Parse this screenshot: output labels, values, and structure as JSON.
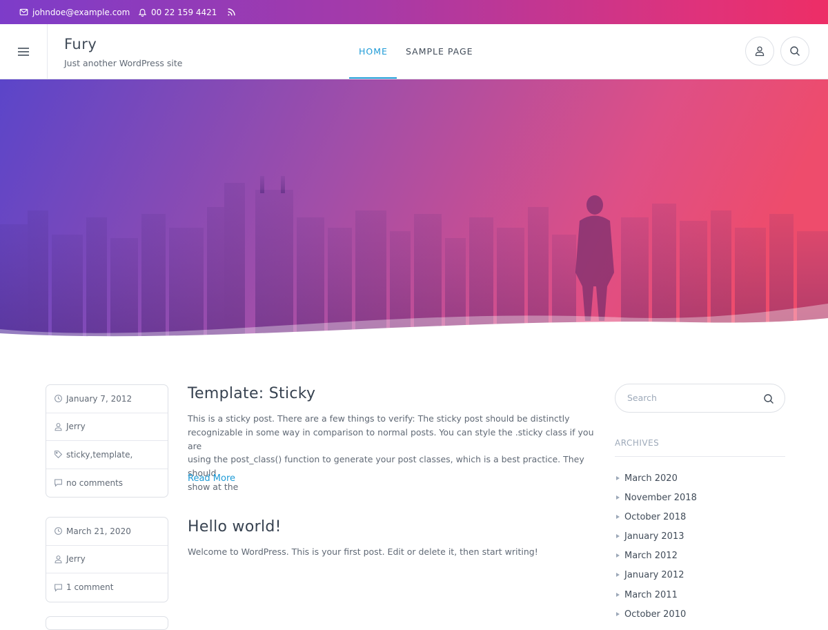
{
  "topbar": {
    "email": "johndoe@example.com",
    "phone": "00 22 159 4421",
    "email_icon": "mail-icon",
    "phone_icon": "bell-icon",
    "rss_icon": "rss-icon"
  },
  "header": {
    "site_title": "Fury",
    "site_description": "Just another WordPress site",
    "nav": [
      {
        "label": "HOME",
        "active": true
      },
      {
        "label": "SAMPLE PAGE",
        "active": false
      }
    ],
    "account_icon": "user-icon",
    "search_icon": "search-icon",
    "menu_icon": "hamburger-icon"
  },
  "colors": {
    "accent": "#1e9bd7",
    "gradient_start": "#7d3cc9",
    "gradient_end": "#ed2e66"
  },
  "posts": [
    {
      "title": "Template: Sticky",
      "meta": {
        "date": "January 7, 2012",
        "author": "Jerry",
        "tags": "sticky,template,",
        "comments": "no comments"
      },
      "excerpt_lines": [
        "This is a sticky post. There are a few things to verify: The sticky post should be distinctly",
        "recognizable in some way in comparison to normal posts. You can style the .sticky class if you are",
        "using the post_class() function to generate your post classes, which is a best practice. They should",
        "show at the"
      ],
      "read_more": "Read More"
    },
    {
      "title": "Hello world!",
      "meta": {
        "date": "March 21, 2020",
        "author": "Jerry",
        "comments": "1 comment"
      },
      "excerpt": "Welcome to WordPress. This is your first post. Edit or delete it, then start writing!"
    }
  ],
  "sidebar": {
    "search_placeholder": "Search",
    "archives_title": "ARCHIVES",
    "archives": [
      "March 2020",
      "November 2018",
      "October 2018",
      "January 2013",
      "March 2012",
      "January 2012",
      "March 2011",
      "October 2010"
    ]
  }
}
